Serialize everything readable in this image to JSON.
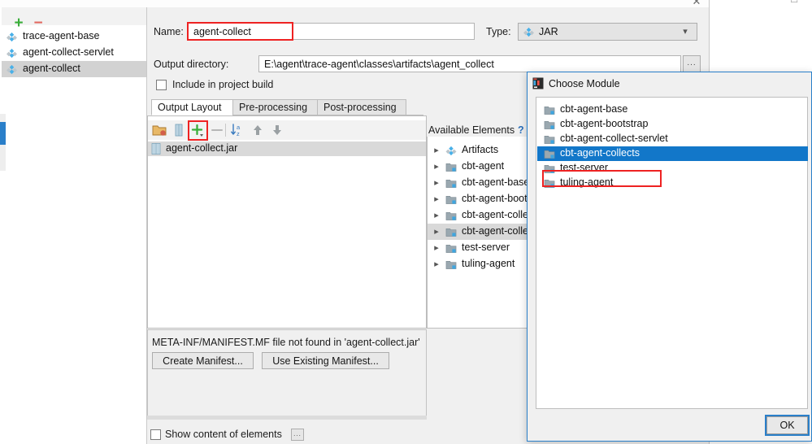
{
  "window": {
    "close_icon": "close-icon",
    "restore_icon": "restore-icon"
  },
  "artifacts_panel": {
    "add_icon": "plus-icon",
    "remove_icon": "minus-icon",
    "items": [
      {
        "label": "trace-agent-base",
        "icon": "artifact-diamond-icon",
        "selected": false
      },
      {
        "label": "agent-collect-servlet",
        "icon": "artifact-diamond-icon",
        "selected": false
      },
      {
        "label": "agent-collect",
        "icon": "artifact-diamond-icon",
        "selected": true
      }
    ]
  },
  "form": {
    "name_label": "Name:",
    "name_value": "agent-collect",
    "type_label": "Type:",
    "type_value": "JAR",
    "type_icon": "artifact-diamond-icon",
    "type_arrow_icon": "chevron-down-icon",
    "output_dir_label": "Output directory:",
    "output_dir_value": "E:\\agent\\trace-agent\\classes\\artifacts\\agent_collect",
    "browse_label": "...",
    "include_in_build_label": "Include in project build",
    "include_in_build_checked": false
  },
  "tabs": [
    {
      "label": "Output Layout",
      "active": true
    },
    {
      "label": "Pre-processing",
      "active": false
    },
    {
      "label": "Post-processing",
      "active": false
    }
  ],
  "layout_toolbar": {
    "icons": [
      {
        "name": "add-directory-icon"
      },
      {
        "name": "add-archive-icon"
      },
      {
        "name": "add-copy-icon"
      },
      {
        "name": "remove-icon"
      },
      {
        "name": "sort-alphabetically-icon"
      },
      {
        "name": "move-up-icon"
      },
      {
        "name": "move-down-icon"
      }
    ]
  },
  "output_layout_tree": {
    "rows": [
      {
        "label": "agent-collect.jar",
        "icon": "jar-icon",
        "selected": true
      }
    ]
  },
  "available_elements": {
    "title": "Available Elements",
    "help_label": "?",
    "rows": [
      {
        "label": "Artifacts",
        "icon": "artifact-diamond-icon",
        "chevron": "chevron-right-icon",
        "selected": false
      },
      {
        "label": "cbt-agent",
        "icon": "module-icon",
        "chevron": "chevron-right-icon",
        "selected": false
      },
      {
        "label": "cbt-agent-base",
        "icon": "module-icon",
        "chevron": "chevron-right-icon",
        "selected": false
      },
      {
        "label": "cbt-agent-boot",
        "icon": "module-icon",
        "chevron": "chevron-right-icon",
        "selected": false
      },
      {
        "label": "cbt-agent-colle",
        "icon": "module-icon",
        "chevron": "chevron-right-icon",
        "selected": false
      },
      {
        "label": "cbt-agent-colle",
        "icon": "module-icon",
        "chevron": "chevron-right-icon",
        "selected": true
      },
      {
        "label": "test-server",
        "icon": "module-icon",
        "chevron": "chevron-right-icon",
        "selected": false
      },
      {
        "label": "tuling-agent",
        "icon": "module-icon",
        "chevron": "chevron-right-icon",
        "selected": false
      }
    ]
  },
  "manifest": {
    "message": "META-INF/MANIFEST.MF file not found in 'agent-collect.jar'",
    "create_button": "Create Manifest...",
    "use_existing_button": "Use Existing Manifest..."
  },
  "bottom_bar": {
    "show_content_label": "Show content of elements",
    "show_content_checked": false,
    "ellipsis_label": "..."
  },
  "choose_module_dialog": {
    "title": "Choose Module",
    "title_icon": "intellij-idea-icon",
    "ok_button": "OK",
    "items": [
      {
        "label": "cbt-agent-base",
        "icon": "module-icon",
        "selected": false
      },
      {
        "label": "cbt-agent-bootstrap",
        "icon": "module-icon",
        "selected": false
      },
      {
        "label": "cbt-agent-collect-servlet",
        "icon": "module-icon",
        "selected": false
      },
      {
        "label": "cbt-agent-collects",
        "icon": "module-icon",
        "selected": true
      },
      {
        "label": "test-server",
        "icon": "module-icon",
        "selected": false
      },
      {
        "label": "tuling-agent",
        "icon": "module-icon",
        "selected": false
      }
    ]
  },
  "highlights": {
    "color": "#ee2222",
    "targets": [
      "name-input",
      "add-copy-icon",
      "cbt-agent-collects-row",
      "available-module-icon"
    ]
  }
}
